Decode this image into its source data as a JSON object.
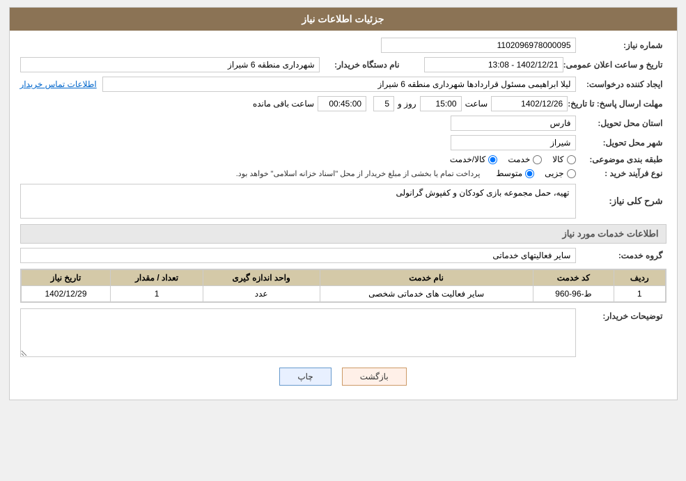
{
  "header": {
    "title": "جزئیات اطلاعات نیاز"
  },
  "fields": {
    "shomareNiaz_label": "شماره نیاز:",
    "shomareNiaz_value": "1102096978000095",
    "namDastgah_label": "نام دستگاه خریدار:",
    "namDastgah_value": "شهرداری منطقه 6 شیراز",
    "tarikh_label": "تاریخ و ساعت اعلان عمومی:",
    "tarikh_value": "1402/12/21 - 13:08",
    "ejadKonande_label": "ایجاد کننده درخواست:",
    "ejadKonande_value": "لیلا ابراهیمی مسئول قراردادها شهرداری منطقه 6 شیراز",
    "ettelaatLink": "اطلاعات تماس خریدار",
    "mohlat_label": "مهلت ارسال پاسخ: تا تاریخ:",
    "mohlat_date": "1402/12/26",
    "mohlat_saat_label": "ساعت",
    "mohlat_saat_value": "15:00",
    "mohlat_roz_label": "روز و",
    "mohlat_roz_value": "5",
    "mohlat_baqi": "00:45:00",
    "mohlat_baqi_label": "ساعت باقی مانده",
    "ostan_label": "استان محل تحویل:",
    "ostan_value": "فارس",
    "shahr_label": "شهر محل تحویل:",
    "shahr_value": "شیراز",
    "tabaqe_label": "طبقه بندی موضوعی:",
    "tabaqe_kala": "کالا",
    "tabaqe_khedmat": "خدمت",
    "tabaqe_kala_khedmat": "کالا/خدمت",
    "noeFarayand_label": "نوع فرآیند خرید :",
    "noeFarayand_jozei": "جزیی",
    "noeFarayand_motavasset": "متوسط",
    "noeFarayand_note": "پرداخت تمام یا بخشی از مبلغ خریدار از محل \"اسناد خزانه اسلامی\" خواهد بود.",
    "sharh_label": "شرح کلی نیاز:",
    "sharh_value": "تهیه، حمل مجموعه بازی کودکان و کفپوش گرانولی",
    "khadamat_label": "اطلاعات خدمات مورد نیاز",
    "grouh_label": "گروه خدمت:",
    "grouh_value": "سایر فعالیتهای خدماتی",
    "table": {
      "headers": [
        "ردیف",
        "کد خدمت",
        "نام خدمت",
        "واحد اندازه گیری",
        "تعداد / مقدار",
        "تاریخ نیاز"
      ],
      "rows": [
        [
          "1",
          "ط-96-960",
          "سایر فعالیت های خدماتی شخصی",
          "عدد",
          "1",
          "1402/12/29"
        ]
      ]
    },
    "tawsiyat_label": "توضیحات خریدار:",
    "tawsiyat_value": ""
  },
  "buttons": {
    "print": "چاپ",
    "back": "بازگشت"
  }
}
